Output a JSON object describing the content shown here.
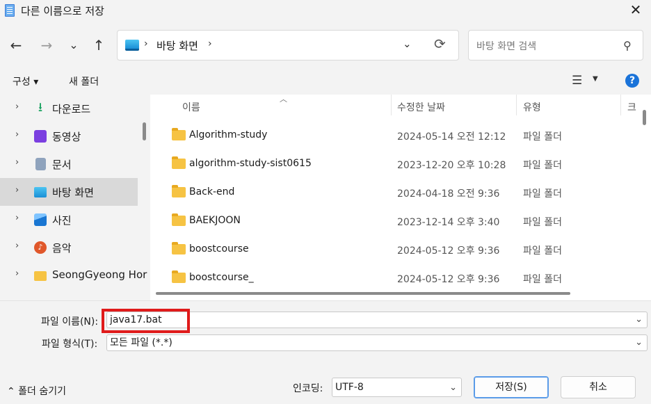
{
  "window": {
    "title": "다른 이름으로 저장",
    "close_label": "✕"
  },
  "nav": {
    "back": "←",
    "forward": "→",
    "recent": "⌄",
    "up": "↑"
  },
  "address": {
    "location": "바탕 화면",
    "sep": "›"
  },
  "search": {
    "placeholder": "바탕 화면 검색"
  },
  "toolbar": {
    "organize": "구성 ▾",
    "new_folder": "새 폴더",
    "help": "?"
  },
  "sidebar": {
    "items": [
      {
        "label": "다운로드",
        "icon": "download-icon",
        "color": "#1aa260"
      },
      {
        "label": "동영상",
        "icon": "video-icon",
        "color": "#7b3fe0"
      },
      {
        "label": "문서",
        "icon": "document-icon",
        "color": "#6b7f99"
      },
      {
        "label": "바탕 화면",
        "icon": "desktop-icon",
        "color": "#1a8fd6",
        "selected": true
      },
      {
        "label": "사진",
        "icon": "photo-icon",
        "color": "#1976d2"
      },
      {
        "label": "음악",
        "icon": "music-icon",
        "color": "#e0572a"
      },
      {
        "label": "SeongGyeong Hor",
        "icon": "folder-icon",
        "color": "#f6c343"
      }
    ]
  },
  "columns": {
    "name": "이름",
    "date": "수정한 날짜",
    "type": "유형",
    "size": "크"
  },
  "files": [
    {
      "name": "Algorithm-study",
      "date": "2024-05-14 오전 12:12",
      "type": "파일 폴더"
    },
    {
      "name": "algorithm-study-sist0615",
      "date": "2023-12-20 오후 10:28",
      "type": "파일 폴더"
    },
    {
      "name": "Back-end",
      "date": "2024-04-18 오전 9:36",
      "type": "파일 폴더"
    },
    {
      "name": "BAEKJOON",
      "date": "2023-12-14 오후 3:40",
      "type": "파일 폴더"
    },
    {
      "name": "boostcourse",
      "date": "2024-05-12 오후 9:36",
      "type": "파일 폴더"
    },
    {
      "name": "boostcourse_",
      "date": "2024-05-12 오후 9:36",
      "type": "파일 폴더"
    }
  ],
  "form": {
    "filename_label": "파일 이름(N):",
    "filename_value": "java17.bat",
    "filetype_label": "파일 형식(T):",
    "filetype_value": "모든 파일  (*.*)",
    "encoding_label": "인코딩:",
    "encoding_value": "UTF-8",
    "save": "저장(S)",
    "cancel": "취소",
    "hide_folders": "⌃ 폴더 숨기기"
  },
  "colors": {
    "accent": "#1a73d9",
    "highlight": "#e01b1b"
  }
}
